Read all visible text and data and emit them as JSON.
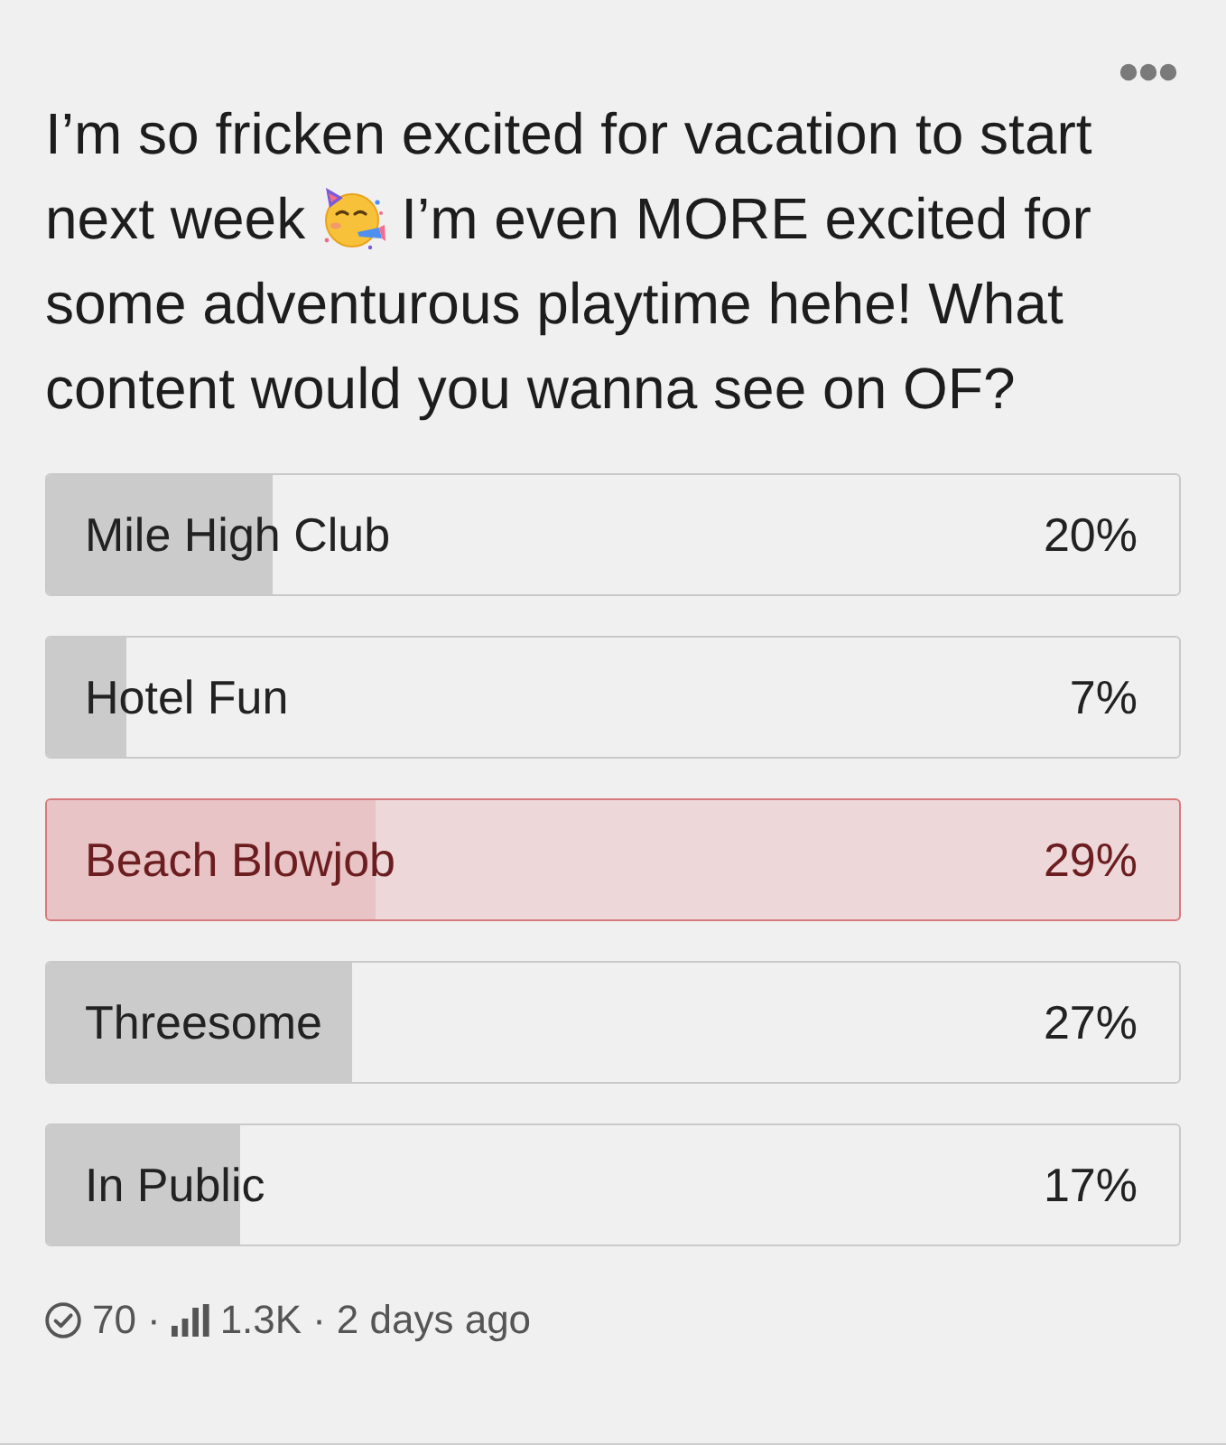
{
  "question_parts": [
    "I’m so fricken excited for vacation to start next week",
    "I’m even MORE excited for some adventurous playtime hehe! What content would you wanna see on OF?"
  ],
  "options": [
    {
      "label": "Mile High Club",
      "percent": "20%",
      "level": 0.2,
      "selected": false
    },
    {
      "label": "Hotel Fun",
      "percent": "7%",
      "level": 0.07,
      "selected": false
    },
    {
      "label": "Beach Blowjob",
      "percent": "29%",
      "level": 0.29,
      "selected": true
    },
    {
      "label": "Threesome",
      "percent": "27%",
      "level": 0.27,
      "selected": false
    },
    {
      "label": "In Public",
      "percent": "17%",
      "level": 0.17,
      "selected": false
    }
  ],
  "footer": {
    "votes": "70",
    "separators": [
      "·",
      "·"
    ],
    "views": "1.3K",
    "posted": "2 days ago"
  }
}
